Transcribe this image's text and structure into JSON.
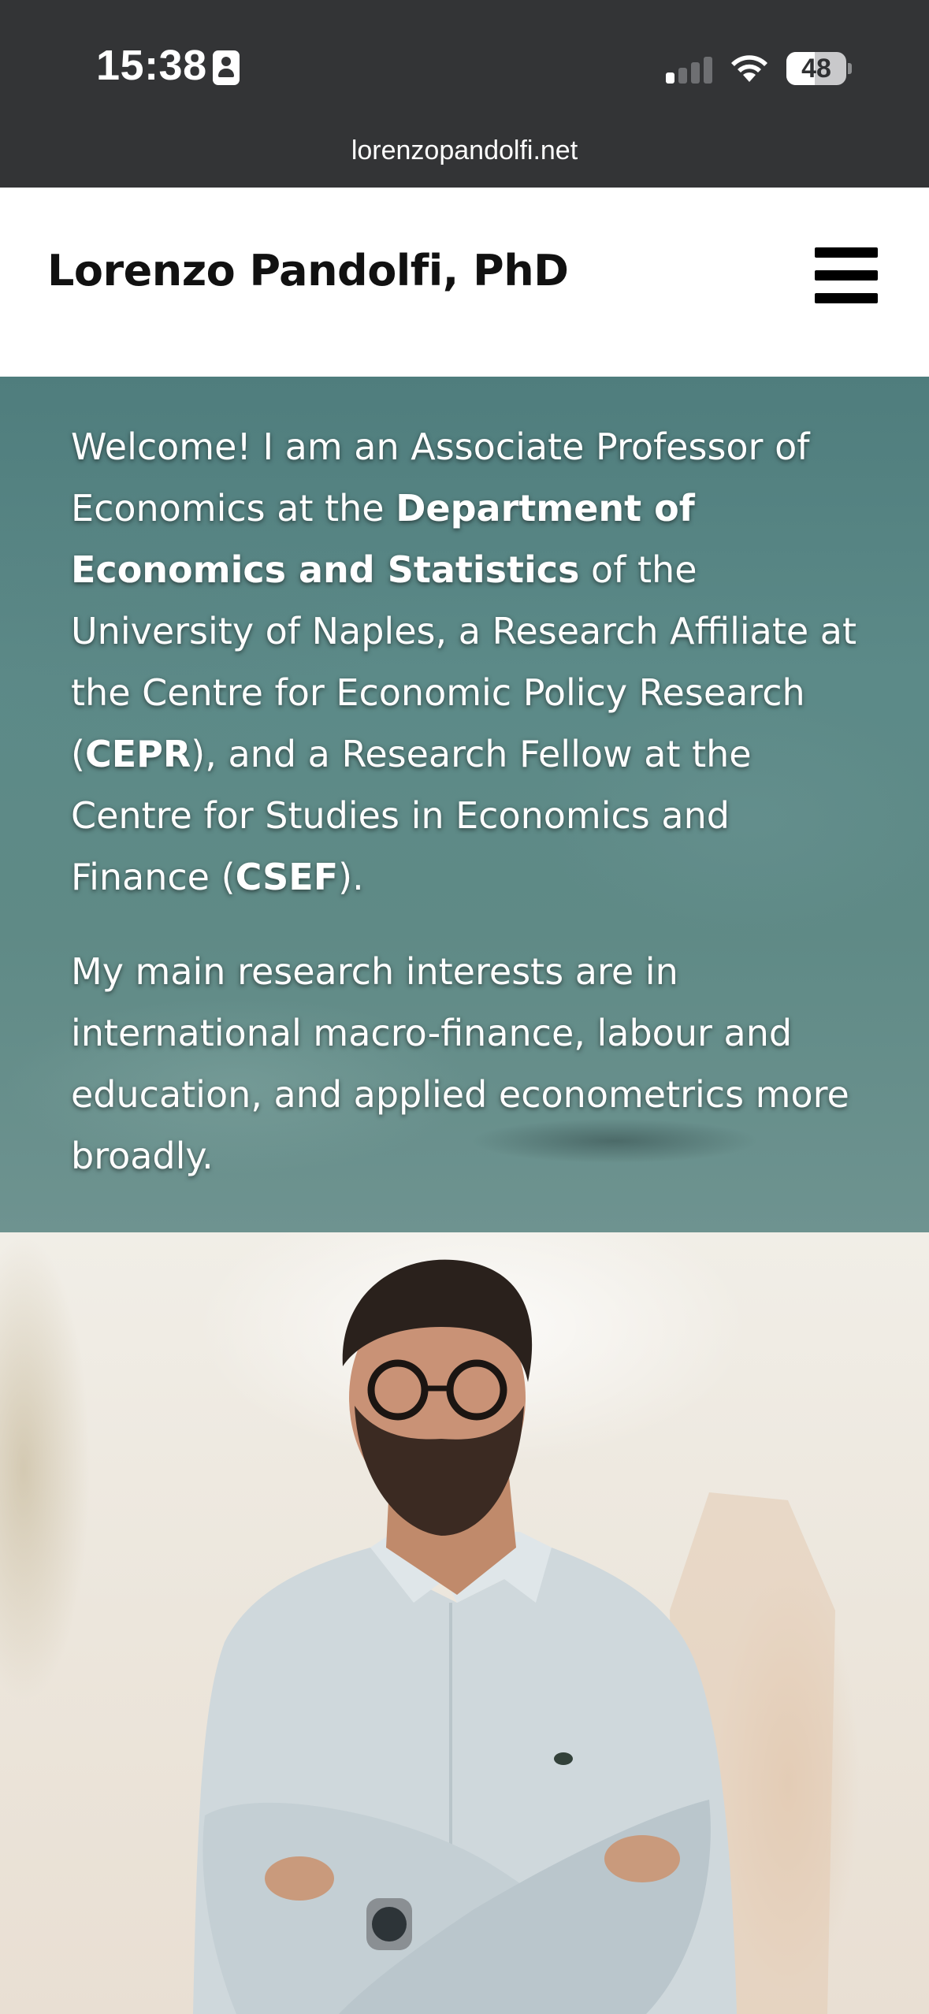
{
  "status_bar": {
    "time": "15:38",
    "battery_level": "48",
    "battery_fraction": 0.48,
    "icons": [
      "contact-card-icon",
      "cellular-signal-icon",
      "wifi-icon",
      "battery-icon"
    ]
  },
  "browser": {
    "url": "lorenzopandolfi.net"
  },
  "header": {
    "site_title": "Lorenzo Pandolfi, PhD",
    "menu_icon": "hamburger-menu-icon"
  },
  "intro": {
    "p1_part1": "Welcome! I am an Associate Professor of Economics at the ",
    "p1_dept": "Department of Economics and Statistics",
    "p1_part2": " of the University of Naples, a Research Affiliate at the Centre for Economic Policy Research (",
    "p1_cepr": "CEPR",
    "p1_part3": "), and a Research Fellow at the Centre for Studies in Economics and Finance (",
    "p1_csef": "CSEF",
    "p1_part4": ").",
    "p2": "My main research interests are in international macro-finance, labour and education, and applied econometrics more broadly."
  },
  "colors": {
    "status_bg": "#333436",
    "intro_bg": "#5c8a88",
    "header_bg": "#ffffff",
    "title_text": "#111111"
  }
}
